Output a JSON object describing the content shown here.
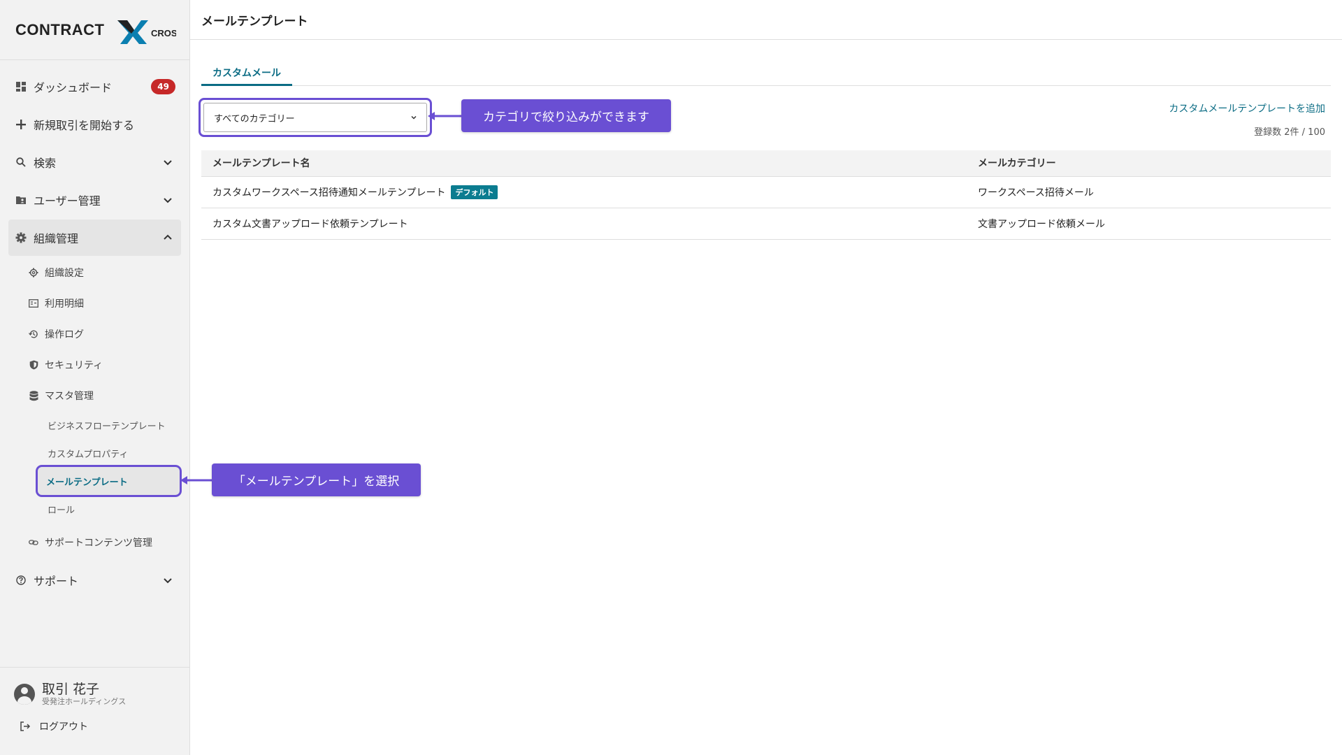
{
  "sidebar": {
    "logo_text": "CONTRACT X CROSS",
    "dashboard_label": "ダッシュボード",
    "dashboard_badge": "49",
    "new_deal_label": "新規取引を開始する",
    "search_label": "検索",
    "user_mgmt_label": "ユーザー管理",
    "org_mgmt_label": "組織管理",
    "org_sub": {
      "org_settings": "組織設定",
      "usage": "利用明細",
      "audit_log": "操作ログ",
      "security": "セキュリティ",
      "master": "マスタ管理",
      "support_content": "サポートコンテンツ管理"
    },
    "master_sub": {
      "business_flow": "ビジネスフローテンプレート",
      "custom_property": "カスタムプロパティ",
      "mail_template": "メールテンプレート",
      "role": "ロール"
    },
    "support_label": "サポート",
    "user": {
      "name": "取引 花子",
      "org": "受発注ホールディングス"
    },
    "logout_label": "ログアウト"
  },
  "main": {
    "page_title": "メールテンプレート",
    "tab_label": "カスタムメール",
    "category_select_value": "すべてのカテゴリー",
    "add_link": "カスタムメールテンプレートを追加",
    "count_text": "登録数 2件 / 100",
    "table": {
      "columns": [
        "メールテンプレート名",
        "メールカテゴリー"
      ],
      "rows": [
        {
          "name": "カスタムワークスペース招待通知メールテンプレート",
          "tag": "デフォルト",
          "category": "ワークスペース招待メール"
        },
        {
          "name": "カスタム文書アップロード依頼テンプレート",
          "tag": "",
          "category": "文書アップロード依頼メール"
        }
      ]
    }
  },
  "callouts": {
    "filter_note": "カテゴリで絞り込みができます",
    "select_note": "「メールテンプレート」を選択"
  },
  "colors": {
    "accent": "#0b6c84",
    "callout": "#6a4fd3",
    "badge": "#c62828",
    "tag": "#0b7c90"
  }
}
